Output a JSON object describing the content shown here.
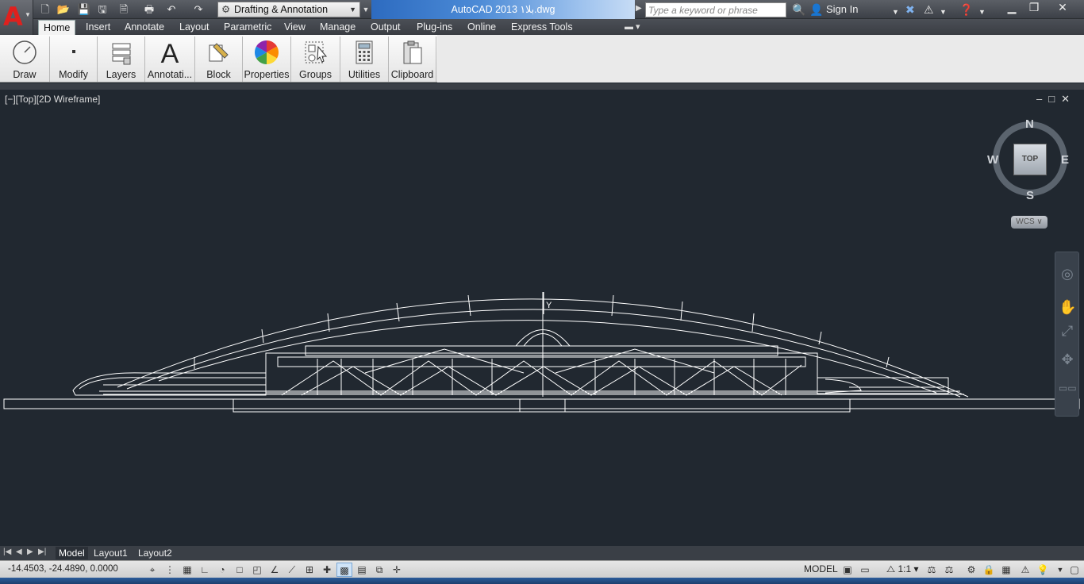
{
  "titlebar": {
    "workspace": "Drafting & Annotation",
    "title": "AutoCAD 2013    ۱بلا.dwg",
    "search_placeholder": "Type a keyword or phrase",
    "sign_in": "Sign In"
  },
  "tabs": [
    "Home",
    "Insert",
    "Annotate",
    "Layout",
    "Parametric",
    "View",
    "Manage",
    "Output",
    "Plug-ins",
    "Online",
    "Express Tools"
  ],
  "ribbon": {
    "draw": "Draw",
    "modify": "Modify",
    "layers": "Layers",
    "annotation": "Annotati...",
    "block": "Block",
    "properties": "Properties",
    "groups": "Groups",
    "utilities": "Utilities",
    "clipboard": "Clipboard"
  },
  "viewport": {
    "label": "[−][Top][2D Wireframe]",
    "controls": "–□✕",
    "y_axis_label": "Y"
  },
  "viewcube": {
    "n": "N",
    "s": "S",
    "e": "E",
    "w": "W",
    "top": "TOP",
    "wcs": "WCS ∨"
  },
  "layout_tabs": {
    "model": "Model",
    "layout1": "Layout1",
    "layout2": "Layout2"
  },
  "statusbar": {
    "coords": "-14.4503, -24.4890, 0.0000",
    "model": "MODEL",
    "scale": "⧍ 1:1 ▾"
  },
  "colors": {
    "canvas": "#212830",
    "accent_red": "#e0201d",
    "title_blue": "#2d6bc0"
  }
}
